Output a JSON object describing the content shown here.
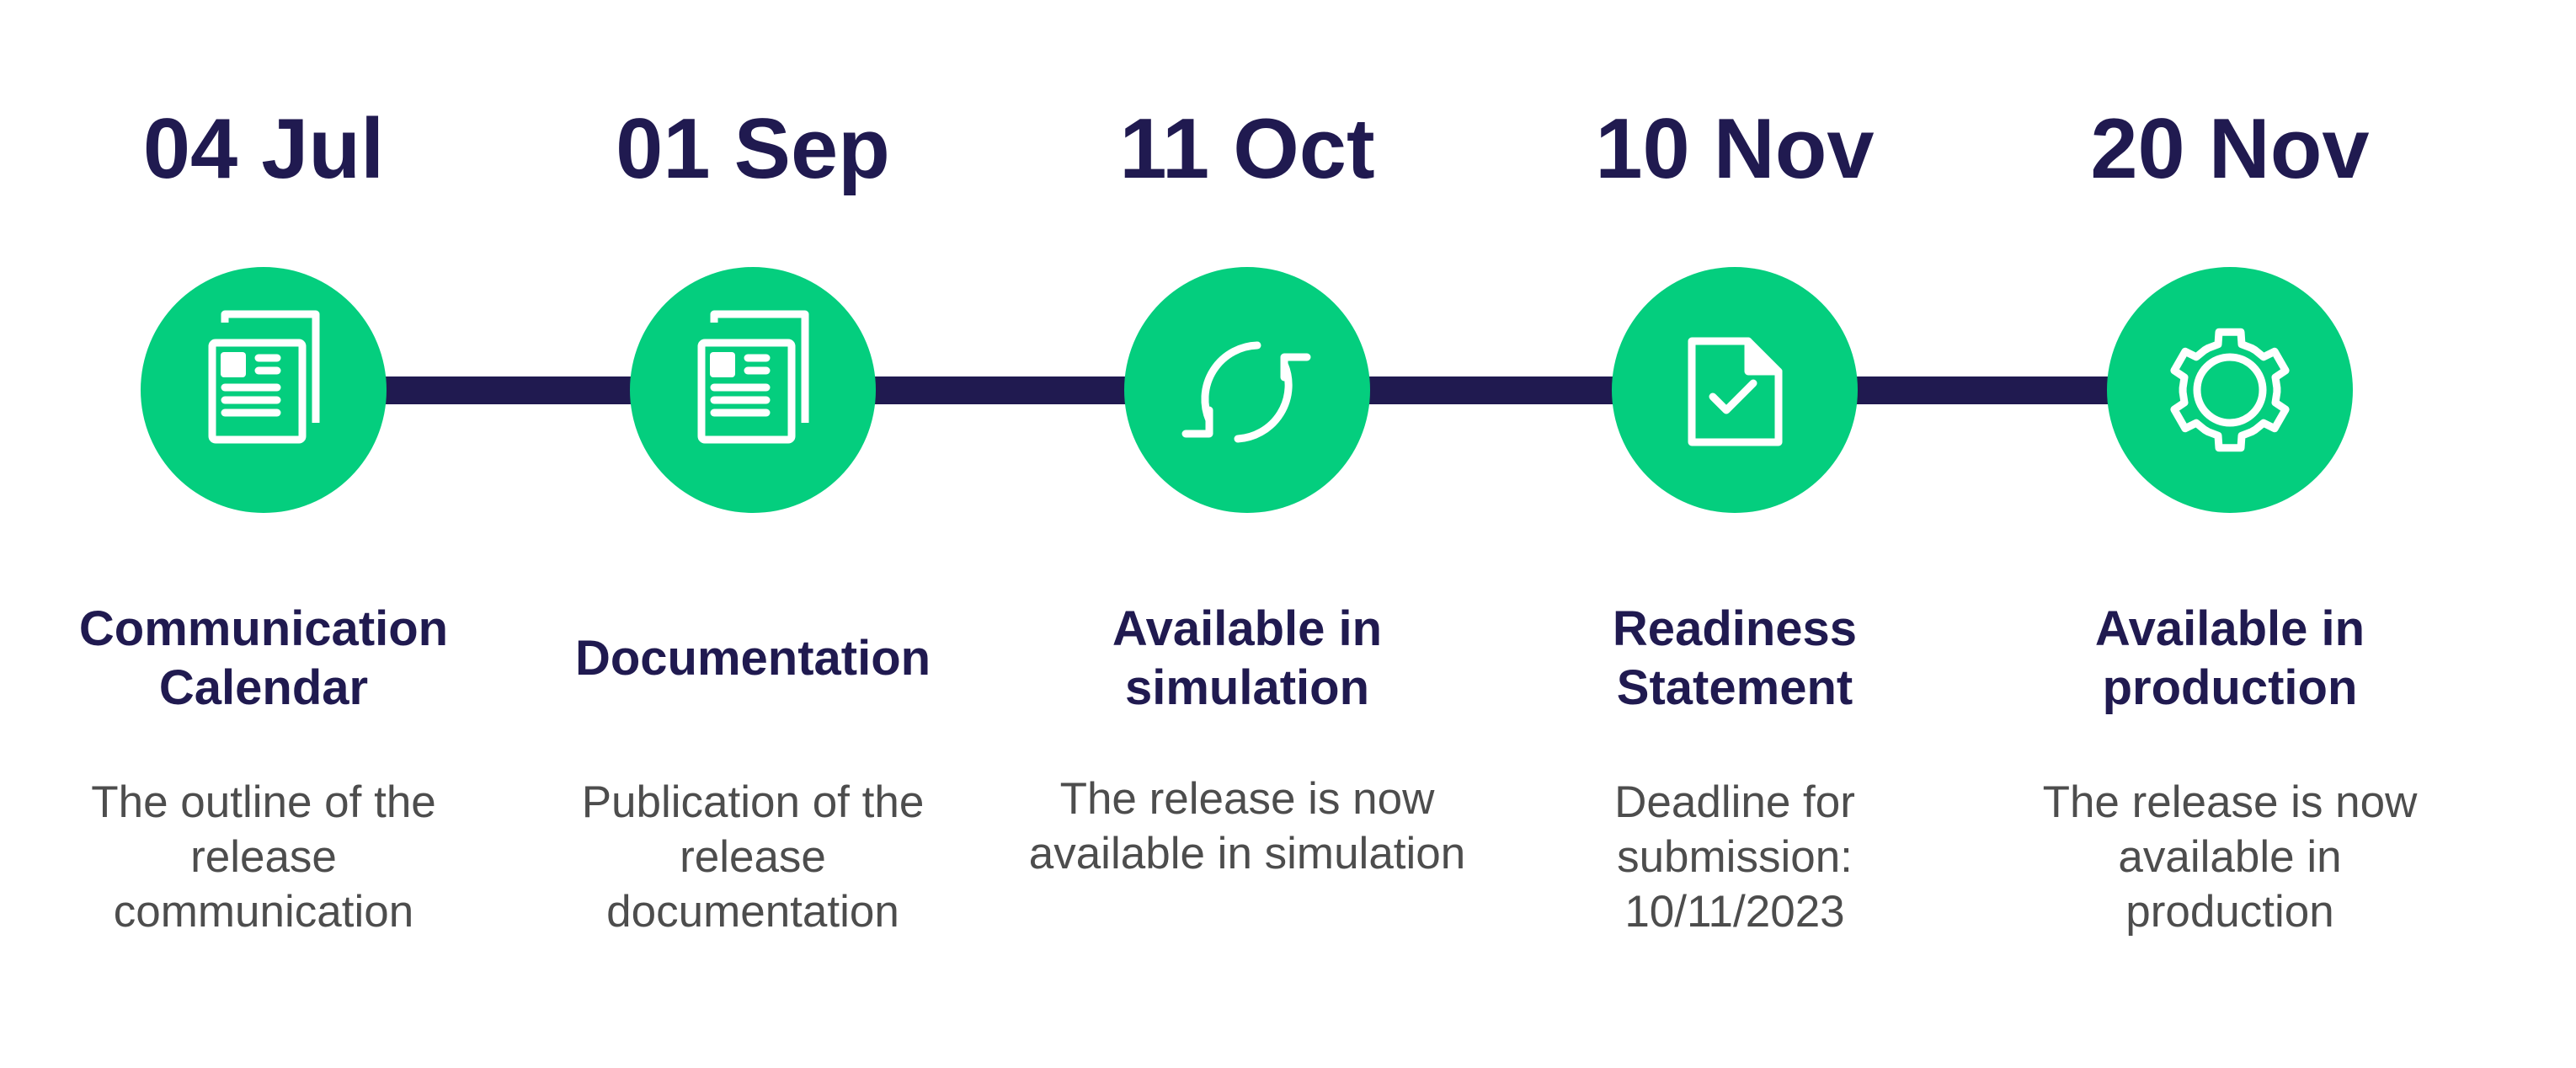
{
  "colors": {
    "accent_green": "#04CE7E",
    "navy": "#201A50",
    "body_text": "#4D4D4D",
    "background": "#FFFFFF"
  },
  "milestones": [
    {
      "date": "04 Jul",
      "icon": "newspaper-icon",
      "title": "Communication Calendar",
      "description": "The outline of the release communication"
    },
    {
      "date": "01 Sep",
      "icon": "newspaper-icon",
      "title": "Documentation",
      "description": "Publication of the release documentation"
    },
    {
      "date": "11 Oct",
      "icon": "refresh-icon",
      "title": "Available in simulation",
      "description": "The release is now available in simulation"
    },
    {
      "date": "10 Nov",
      "icon": "document-check-icon",
      "title": "Readiness Statement",
      "description": "Deadline for submission: 10/11/2023"
    },
    {
      "date": "20 Nov",
      "icon": "gear-icon",
      "title": "Available in production",
      "description": "The release is now available in production"
    }
  ]
}
